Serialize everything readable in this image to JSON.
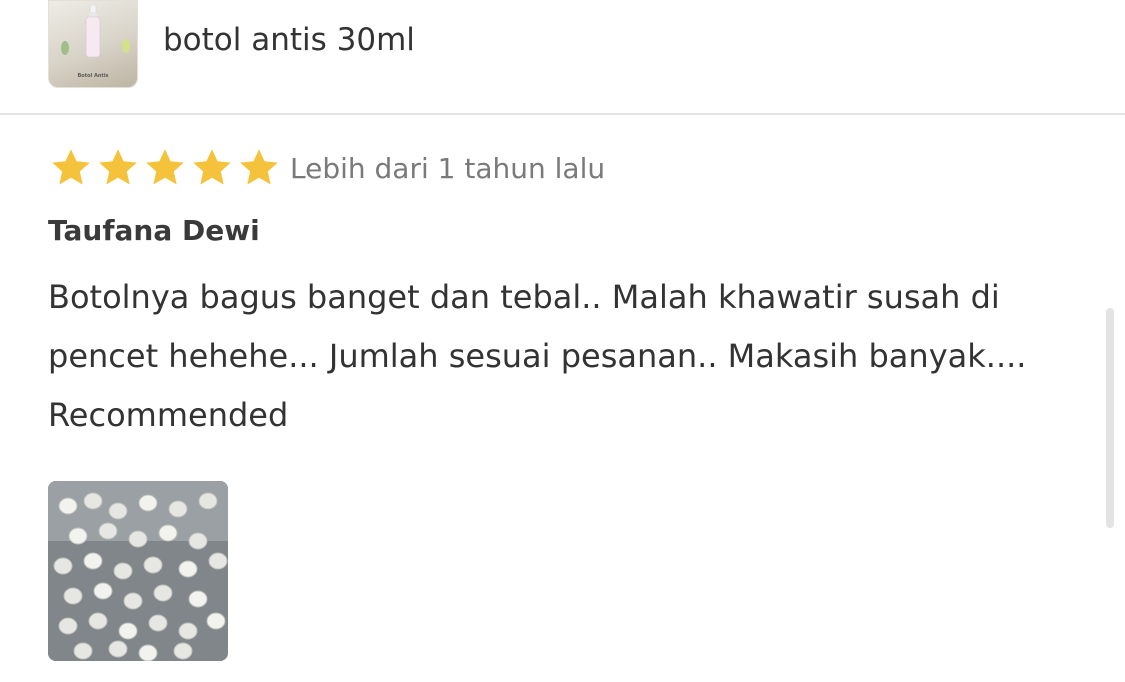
{
  "product": {
    "name": "botol antis 30ml",
    "thumbnail_caption": "Botol Antis",
    "thumbnail_icon": "product-bottle-image"
  },
  "review": {
    "rating": 5,
    "rating_max": 5,
    "star_color": "#f5c33b",
    "time": "Lebih dari 1 tahun lalu",
    "reviewer": "Taufana Dewi",
    "text": "Botolnya bagus banget dan tebal.. Malah khawatir susah di pencet hehehe... Jumlah sesuai pesanan.. Makasih banyak.... Recommended",
    "photo_icon": "review-photo-bottle-caps"
  }
}
